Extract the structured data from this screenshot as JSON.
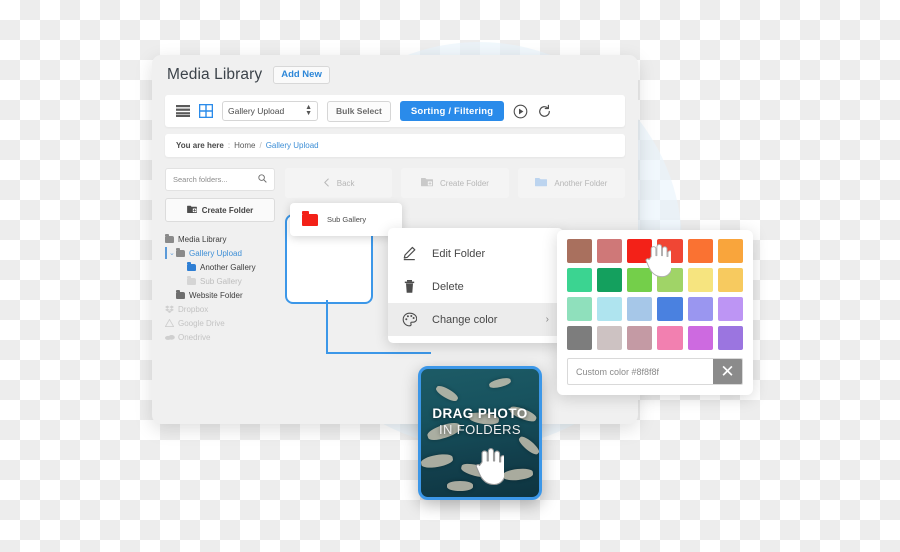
{
  "window": {
    "title": "Media Library",
    "add_new_label": "Add New"
  },
  "toolbar": {
    "list_icon": "list-view-icon",
    "grid_icon": "grid-view-icon",
    "select_value": "Gallery Upload",
    "bulk_select_label": "Bulk Select",
    "sorting_label": "Sorting / Filtering",
    "play_icon": "play-circle-icon",
    "refresh_icon": "refresh-icon",
    "accent_color": "#2a8bea"
  },
  "breadcrumb": {
    "label": "You are here",
    "separator": ":",
    "home": "Home",
    "slash": "/",
    "current": "Gallery Upload"
  },
  "sidebar": {
    "search_placeholder": "Search folders...",
    "search_icon": "search-icon",
    "create_folder_label": "Create Folder",
    "tree": [
      {
        "label": "Media Library",
        "indent": 0,
        "color": "#8a8a8a",
        "text_color": "#3d3d3d",
        "muted": false,
        "type": "folder"
      },
      {
        "label": "Gallery Upload",
        "indent": 1,
        "color": "#8a8a8a",
        "text_color": "#3e8fd6",
        "muted": false,
        "type": "folder",
        "expanded": true,
        "selected": true
      },
      {
        "label": "Another Gallery",
        "indent": 2,
        "color": "#2f7fd4",
        "text_color": "#3d3d3d",
        "muted": false,
        "type": "folder"
      },
      {
        "label": "Sub Gallery",
        "indent": 2,
        "color": "#d5d5d5",
        "text_color": "#bdbdbd",
        "muted": true,
        "type": "folder"
      },
      {
        "label": "Website Folder",
        "indent": 1,
        "color": "#6e6e6e",
        "text_color": "#3d3d3d",
        "muted": false,
        "type": "folder"
      },
      {
        "label": "Dropbox",
        "indent": 0,
        "color": "#cfcfcf",
        "text_color": "#c3c3c3",
        "muted": true,
        "type": "dropbox"
      },
      {
        "label": "Google Drive",
        "indent": 0,
        "color": "#cfcfcf",
        "text_color": "#c3c3c3",
        "muted": true,
        "type": "gdrive"
      },
      {
        "label": "Onedrive",
        "indent": 0,
        "color": "#cfcfcf",
        "text_color": "#c3c3c3",
        "muted": true,
        "type": "onedrive"
      }
    ]
  },
  "folder_actions": [
    {
      "label": "Back",
      "icon": "chevron-left-icon"
    },
    {
      "label": "Create Folder",
      "icon": "folder-plus-icon"
    },
    {
      "label": "Another Folder",
      "icon": "folder-icon"
    }
  ],
  "sub_gallery_card": {
    "label": "Sub Gallery",
    "folder_color": "#f32118"
  },
  "context_menu": {
    "items": [
      {
        "label": "Edit Folder",
        "icon": "pencil-icon",
        "active": false,
        "submenu": false
      },
      {
        "label": "Delete",
        "icon": "trash-icon",
        "active": false,
        "submenu": false
      },
      {
        "label": "Change color",
        "icon": "palette-icon",
        "active": true,
        "submenu": true,
        "arrow": "›"
      }
    ]
  },
  "palette": {
    "swatches": [
      "#a9705e",
      "#cf7878",
      "#f32118",
      "#f04634",
      "#fa7232",
      "#f9a53c",
      "#3bd491",
      "#14a05e",
      "#74cf4a",
      "#a0d467",
      "#f6e47f",
      "#f7ca5f",
      "#8fe0bc",
      "#afe4ef",
      "#a6c7e8",
      "#4a81e0",
      "#9a96f0",
      "#bd95f4",
      "#7d7d7d",
      "#cdc2c2",
      "#c49aa4",
      "#f280b0",
      "#cd6ae0",
      "#9b75e0"
    ],
    "custom_placeholder": "Custom color #8f8f8f",
    "close_icon": "close-icon",
    "close_glyph": "✕"
  },
  "drag_photo": {
    "line1": "DRAG PHOTO",
    "line2": "IN FOLDERS",
    "cursor_icon": "hand-pointer-icon"
  }
}
